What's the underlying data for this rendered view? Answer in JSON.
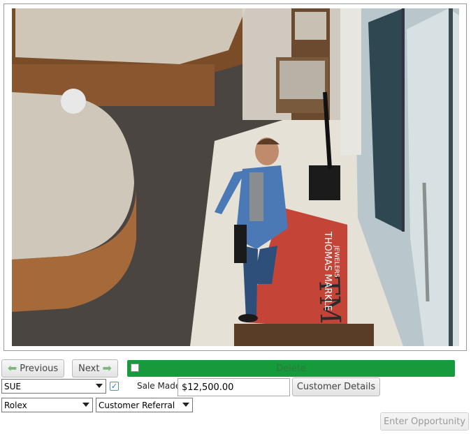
{
  "camera": {
    "mat_brand_name": "THOMAS MARKLE",
    "mat_brand_sub": "JEWELERS",
    "mat_logo": "TM"
  },
  "nav": {
    "previous_label": "Previous",
    "next_label": "Next",
    "previous_icon": "arrow-left-icon",
    "next_icon": "arrow-right-icon"
  },
  "progress": {
    "label": "Delete",
    "color": "#159a3c"
  },
  "form": {
    "salesperson_value": "SUE",
    "sale_made_checked": true,
    "sale_made_label": "Sale Made",
    "sale_amount_value": "$12,500.00",
    "customer_details_label": "Customer Details",
    "brand_value": "Rolex",
    "source_value": "Customer Referral",
    "enter_opportunity_label": "Enter Opportunity"
  }
}
